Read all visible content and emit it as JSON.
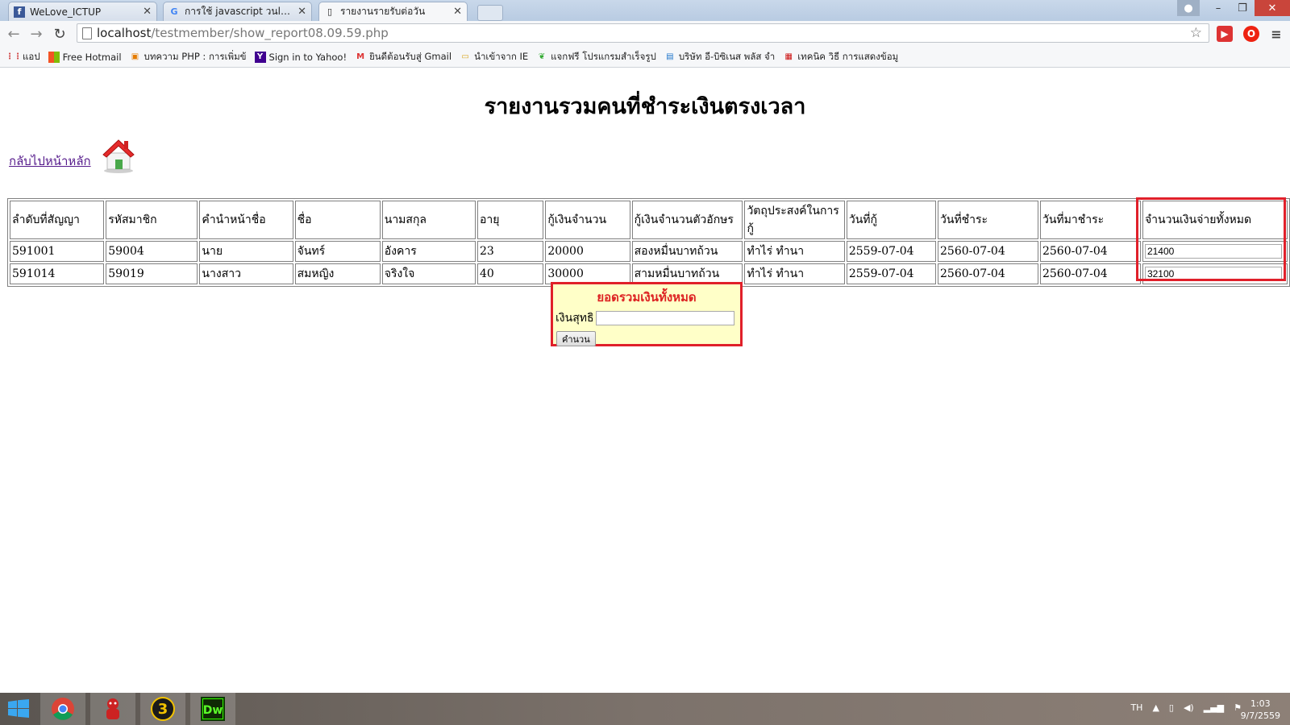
{
  "browser": {
    "tabs": [
      {
        "title": "WeLove_ICTUP",
        "icon": "facebook-icon"
      },
      {
        "title": "การใช้ javascript วนloop โน",
        "icon": "google-icon"
      },
      {
        "title": "รายงานรายรับต่อวัน",
        "icon": "page-icon"
      }
    ],
    "url_host": "localhost",
    "url_path": "/testmember/show_report08.09.59.php",
    "bookmarks": [
      {
        "label": "แอป",
        "icon": "apps-icon"
      },
      {
        "label": "Free Hotmail",
        "icon": "windows-icon"
      },
      {
        "label": "บทความ PHP : การเพิ่มข้",
        "icon": "php-icon"
      },
      {
        "label": "Sign in to Yahoo!",
        "icon": "yahoo-icon"
      },
      {
        "label": "ยินดีต้อนรับสู่ Gmail",
        "icon": "gmail-icon"
      },
      {
        "label": "นำเข้าจาก IE",
        "icon": "folder-icon"
      },
      {
        "label": "แจกฟรี โปรแกรมสำเร็จรูป",
        "icon": "leaf-icon"
      },
      {
        "label": "บริษัท อี-บิซิเนส พลัส จำ",
        "icon": "ebiz-icon"
      },
      {
        "label": "เทคนิค วิธี การแสดงข้อมู",
        "icon": "tech-icon"
      }
    ]
  },
  "page": {
    "title": "รายงานรวมคนที่ชำระเงินตรงเวลา",
    "back_link": "กลับไปหน้าหลัก"
  },
  "table": {
    "headers": [
      "ลำดับที่สัญญา",
      "รหัสมาชิก",
      "คำนำหน้าชื่อ",
      "ชื่อ",
      "นามสกุล",
      "อายุ",
      "กู้เงินจำนวน",
      "กู้เงินจำนวนตัวอักษร",
      "วัตถุประสงค์ในการกู้",
      "วันที่กู้",
      "วันที่ชำระ",
      "วันที่มาชำระ",
      "จำนวนเงินจ่ายทั้งหมด"
    ],
    "rows": [
      [
        "591001",
        "59004",
        "นาย",
        "จันทร์",
        "อังคาร",
        "23",
        "20000",
        "สองหมื่นบาทถ้วน",
        "ทำไร่ ทำนา",
        "2559-07-04",
        "2560-07-04",
        "2560-07-04",
        "21400"
      ],
      [
        "591014",
        "59019",
        "นางสาว",
        "สมหญิง",
        "จริงใจ",
        "40",
        "30000",
        "สามหมื่นบาทถ้วน",
        "ทำไร่ ทำนา",
        "2559-07-04",
        "2560-07-04",
        "2560-07-04",
        "32100"
      ]
    ]
  },
  "summary": {
    "title": "ยอดรวมเงินทั้งหมด",
    "net_label": "เงินสุทธิ",
    "net_value": "",
    "calc_button": "คำนวน"
  },
  "taskbar": {
    "language": "TH",
    "time": "1:03",
    "date": "9/7/2559",
    "apps": [
      "windows-start-icon",
      "chrome-icon",
      "app-red-icon",
      "app-3-icon",
      "dreamweaver-icon"
    ]
  }
}
